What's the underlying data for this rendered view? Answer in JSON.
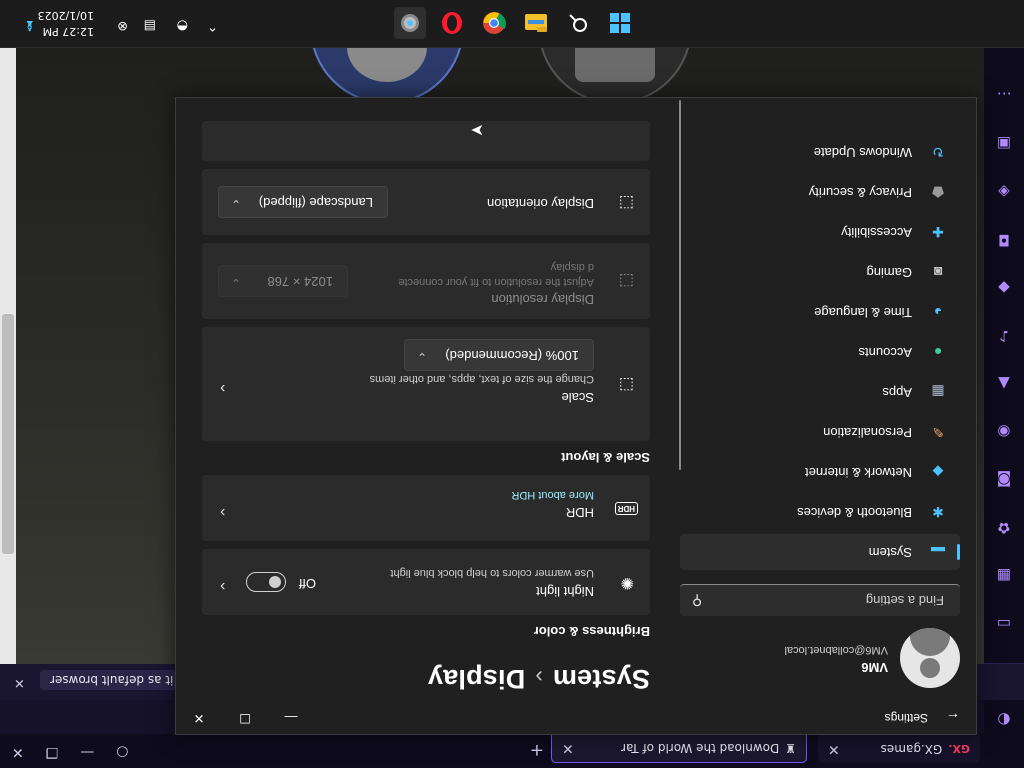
{
  "browser": {
    "tabs": [
      {
        "brand": "GX.",
        "title": "GX.games"
      },
      {
        "title": "Download the World of Tar"
      }
    ],
    "default_browser_text": "it as default browser"
  },
  "settings": {
    "app_title": "Settings",
    "user": {
      "name": "VM6",
      "email": "VM6@collabnet.local"
    },
    "search_placeholder": "Find a setting",
    "nav": [
      {
        "label": "System",
        "active": true
      },
      {
        "label": "Bluetooth & devices"
      },
      {
        "label": "Network & internet"
      },
      {
        "label": "Personalization"
      },
      {
        "label": "Apps"
      },
      {
        "label": "Accounts"
      },
      {
        "label": "Time & language"
      },
      {
        "label": "Gaming"
      },
      {
        "label": "Accessibility"
      },
      {
        "label": "Privacy & security"
      },
      {
        "label": "Windows Update"
      }
    ],
    "breadcrumb": {
      "parent": "System",
      "current": "Display"
    },
    "brightness_section": "Brightness & color",
    "night_light": {
      "title": "Night light",
      "subtitle": "Use warmer colors to help block blue light",
      "state": "Off"
    },
    "hdr": {
      "badge": "HDR",
      "title": "HDR",
      "link": "More about HDR"
    },
    "scale_section": "Scale & layout",
    "scale": {
      "title": "Scale",
      "subtitle": "Change the size of text, apps, and other items",
      "value": "100% (Recommended)"
    },
    "resolution": {
      "title": "Display resolution",
      "subtitle_1": "Adjust the resolution to fit your connecte",
      "subtitle_2": "d display",
      "value": "1024 × 768"
    },
    "orientation": {
      "title": "Display orientation",
      "value": "Landscape (flipped)"
    }
  },
  "taskbar": {
    "time": "12:27 PM",
    "date": "10/1/2023"
  },
  "colors": {
    "accent": "#4cc2ff",
    "window_bg": "#202020",
    "card_bg": "#2b2b2b",
    "opera_purple": "#7a55ff"
  }
}
